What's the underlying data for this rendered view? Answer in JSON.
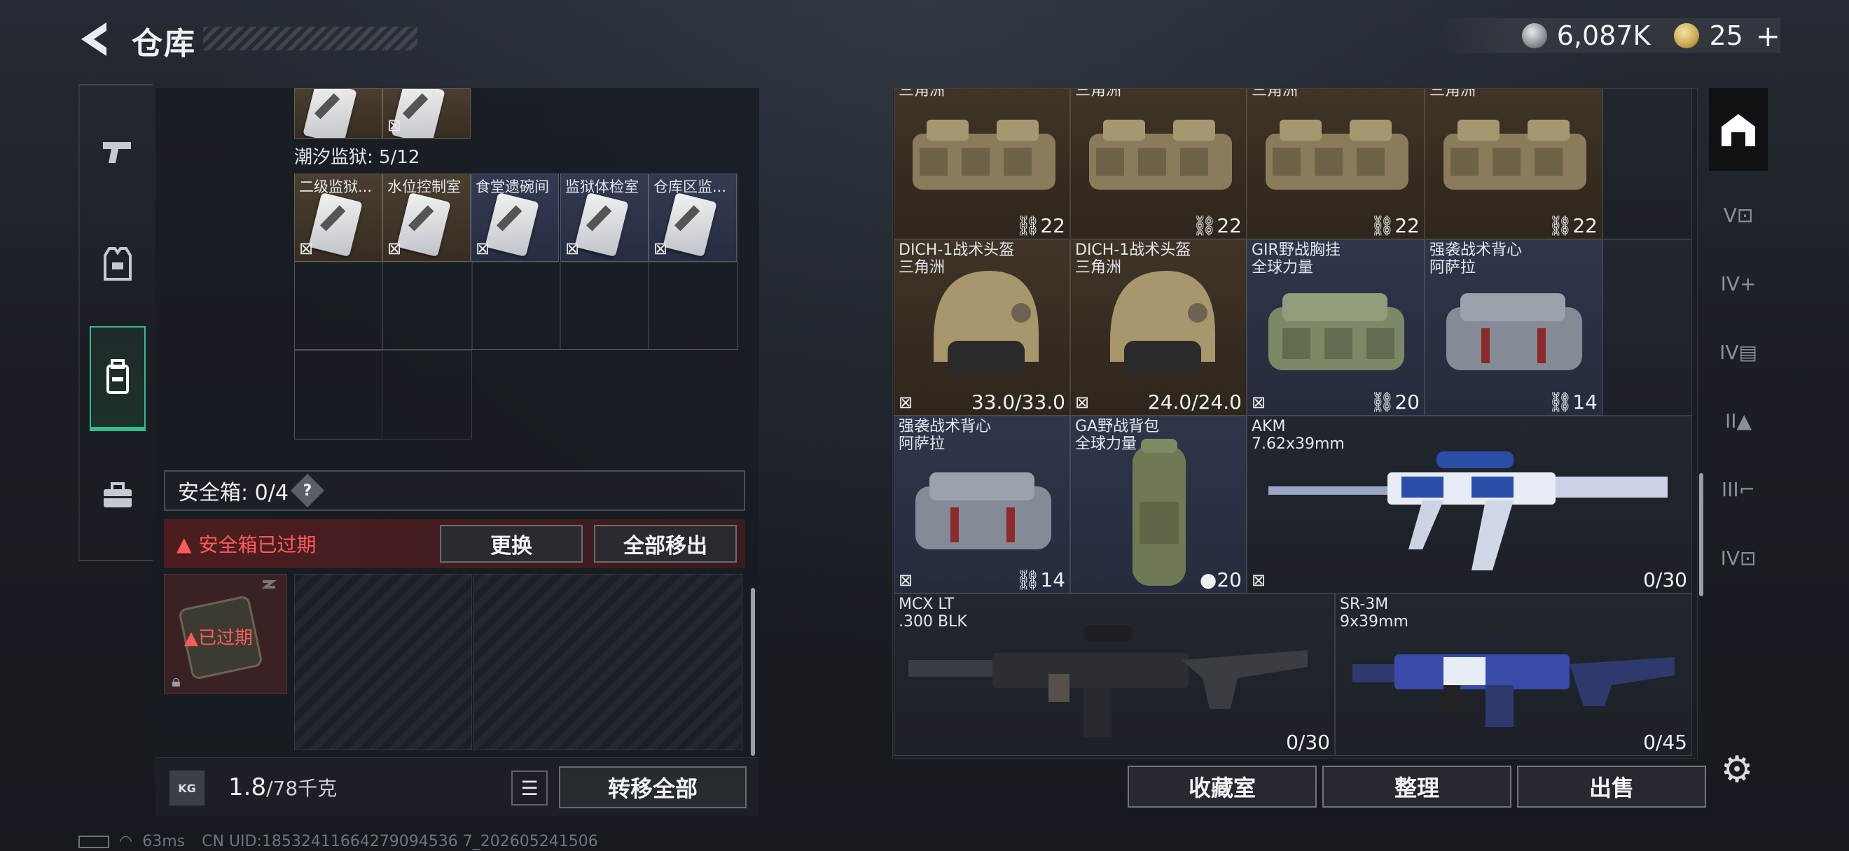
{
  "header": {
    "title": "仓库",
    "currency_silver": "6,087K",
    "currency_gold": "25"
  },
  "left": {
    "section_label": "潮汐监狱: 5/12",
    "cards": [
      {
        "label": "二级监狱..."
      },
      {
        "label": "水位控制室"
      },
      {
        "label": "食堂遗碗间"
      },
      {
        "label": "监狱体检室"
      },
      {
        "label": "仓库区监..."
      }
    ],
    "safe_box_label": "安全箱: 0/4",
    "safe_help": "?",
    "expired_text": "安全箱已过期",
    "replace_btn": "更换",
    "move_all_btn": "全部移出",
    "case_status": "已过期",
    "weight_current": "1.8",
    "weight_total": "/78千克",
    "kg_label": "KG",
    "transfer_all_btn": "转移全部"
  },
  "right": {
    "items": [
      {
        "name": "三角洲",
        "count": "22"
      },
      {
        "name": "三角洲",
        "count": "22"
      },
      {
        "name": "三角洲",
        "count": "22"
      },
      {
        "name": "三角洲",
        "count": "22"
      },
      {
        "name": "DICH-1战术头盔",
        "sub": "三角洲",
        "count": "33.0/33.0"
      },
      {
        "name": "DICH-1战术头盔",
        "sub": "三角洲",
        "count": "24.0/24.0"
      },
      {
        "name": "GIR野战胸挂",
        "sub": "全球力量",
        "count": "20"
      },
      {
        "name": "强袭战术背心",
        "sub": "阿萨拉",
        "count": "14"
      },
      {
        "name": "强袭战术背心",
        "sub": "阿萨拉",
        "count": "14"
      },
      {
        "name": "GA野战背包",
        "sub": "全球力量",
        "count": "20"
      },
      {
        "name": "AKM",
        "sub": "7.62x39mm",
        "count": "0/30"
      },
      {
        "name": "MCX LT",
        "sub": ".300 BLK",
        "count": "0/30"
      },
      {
        "name": "SR-3M",
        "sub": "9x39mm",
        "count": "0/45"
      }
    ],
    "btn_collection": "收藏室",
    "btn_sort": "整理",
    "btn_sell": "出售"
  },
  "status": {
    "ping": "63ms",
    "uid": "CN UID:18532411664279094536 7_202605241506"
  },
  "colors": {
    "accent_green": "#2fbf8a",
    "expired_red": "#ff5b5b",
    "brown_tile": "#3f3427",
    "navy_tile": "#2f364a"
  }
}
